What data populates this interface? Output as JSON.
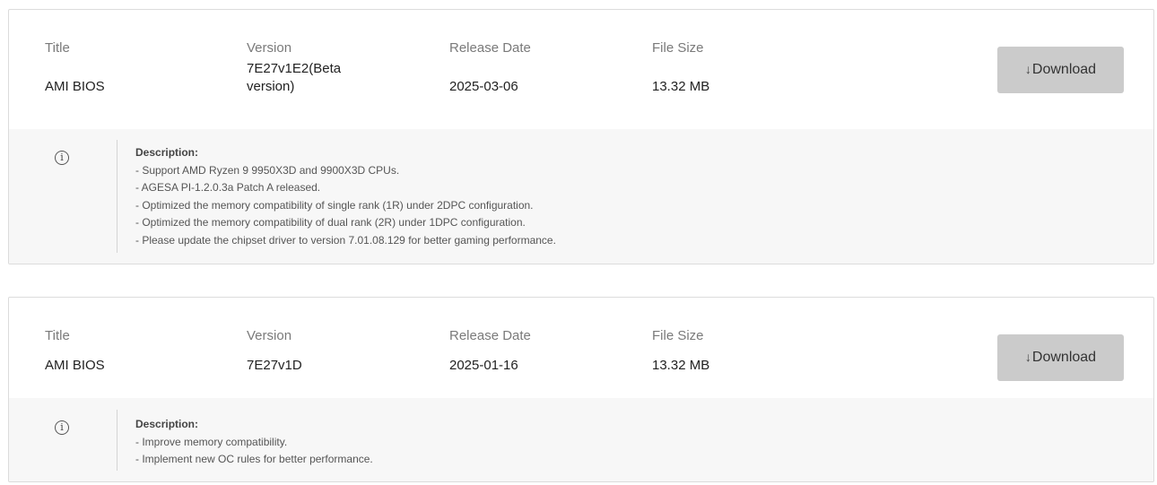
{
  "colors": {
    "button_bg": "#cbcbcb",
    "desc_bg": "#f7f7f7",
    "card_border": "#dcdcdc"
  },
  "headers": {
    "title": "Title",
    "version": "Version",
    "release_date": "Release Date",
    "file_size": "File Size"
  },
  "download_icon": "download-arrow-icon",
  "info_icon": "info-circle-icon",
  "items": [
    {
      "title": "AMI BIOS",
      "version": "7E27v1E2(Beta version)",
      "release_date": "2025-03-06",
      "file_size": "13.32 MB",
      "download_label": "Download",
      "description_heading": "Description:",
      "description_lines": [
        "- Support AMD Ryzen 9 9950X3D and 9900X3D CPUs.",
        "- AGESA PI-1.2.0.3a Patch A released.",
        "- Optimized the memory compatibility of single rank (1R) under 2DPC configuration.",
        "- Optimized the memory compatibility of dual rank (2R) under 1DPC configuration.",
        "- Please update the chipset driver to version 7.01.08.129 for better gaming performance."
      ]
    },
    {
      "title": "AMI BIOS",
      "version": "7E27v1D",
      "release_date": "2025-01-16",
      "file_size": "13.32 MB",
      "download_label": "Download",
      "description_heading": "Description:",
      "description_lines": [
        "- Improve memory compatibility.",
        "- Implement new OC rules for better performance."
      ]
    }
  ]
}
